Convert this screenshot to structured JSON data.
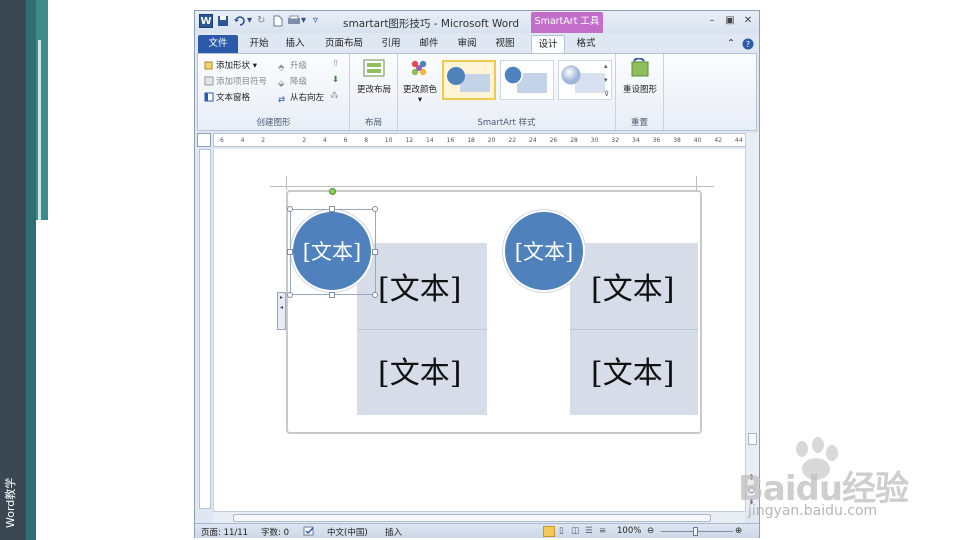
{
  "slide_label": "Word教学",
  "window": {
    "title": "smartart图形技巧 - Microsoft Word",
    "app_icon": "W",
    "tool_tab": "SmartArt 工具"
  },
  "tabs": [
    {
      "label": "文件"
    },
    {
      "label": "开始"
    },
    {
      "label": "插入"
    },
    {
      "label": "页面布局"
    },
    {
      "label": "引用"
    },
    {
      "label": "邮件"
    },
    {
      "label": "审阅"
    },
    {
      "label": "视图"
    },
    {
      "label": "设计"
    },
    {
      "label": "格式"
    }
  ],
  "ribbon": {
    "create_group": {
      "label": "创建图形",
      "add_shape": "添加形状",
      "add_bullet": "添加项目符号",
      "text_pane": "文本窗格",
      "promote": "升级",
      "demote": "降级",
      "right_to_left": "从右向左"
    },
    "layout_group": {
      "label": "布局",
      "change_layout": "更改布局"
    },
    "styles_group": {
      "label": "SmartArt 样式",
      "change_colors": "更改颜色"
    },
    "reset_group": {
      "label": "重置",
      "reset_graphic": "重设图形"
    }
  },
  "ruler_ticks": [
    "6",
    "4",
    "2",
    "",
    "2",
    "4",
    "6",
    "8",
    "10",
    "12",
    "14",
    "16",
    "18",
    "20",
    "22",
    "24",
    "26",
    "28",
    "30",
    "32",
    "34",
    "36",
    "38",
    "40",
    "42",
    "44"
  ],
  "smartart": {
    "left_circle": "[文本]",
    "left_top": "[文本]",
    "left_bottom": "[文本]",
    "right_circle": "[文本]",
    "right_top": "[文本]",
    "right_bottom": "[文本]"
  },
  "status": {
    "page": "页面: 11/11",
    "words": "字数: 0",
    "language": "中文(中国)",
    "mode": "插入",
    "zoom": "100%"
  },
  "watermark": {
    "brand": "Baidu经验",
    "site": "jingyan.baidu.com"
  },
  "colors": {
    "accent": "#4f81bd",
    "tool_tab": "#c36fc9",
    "file_tab": "#2a5aa9"
  }
}
